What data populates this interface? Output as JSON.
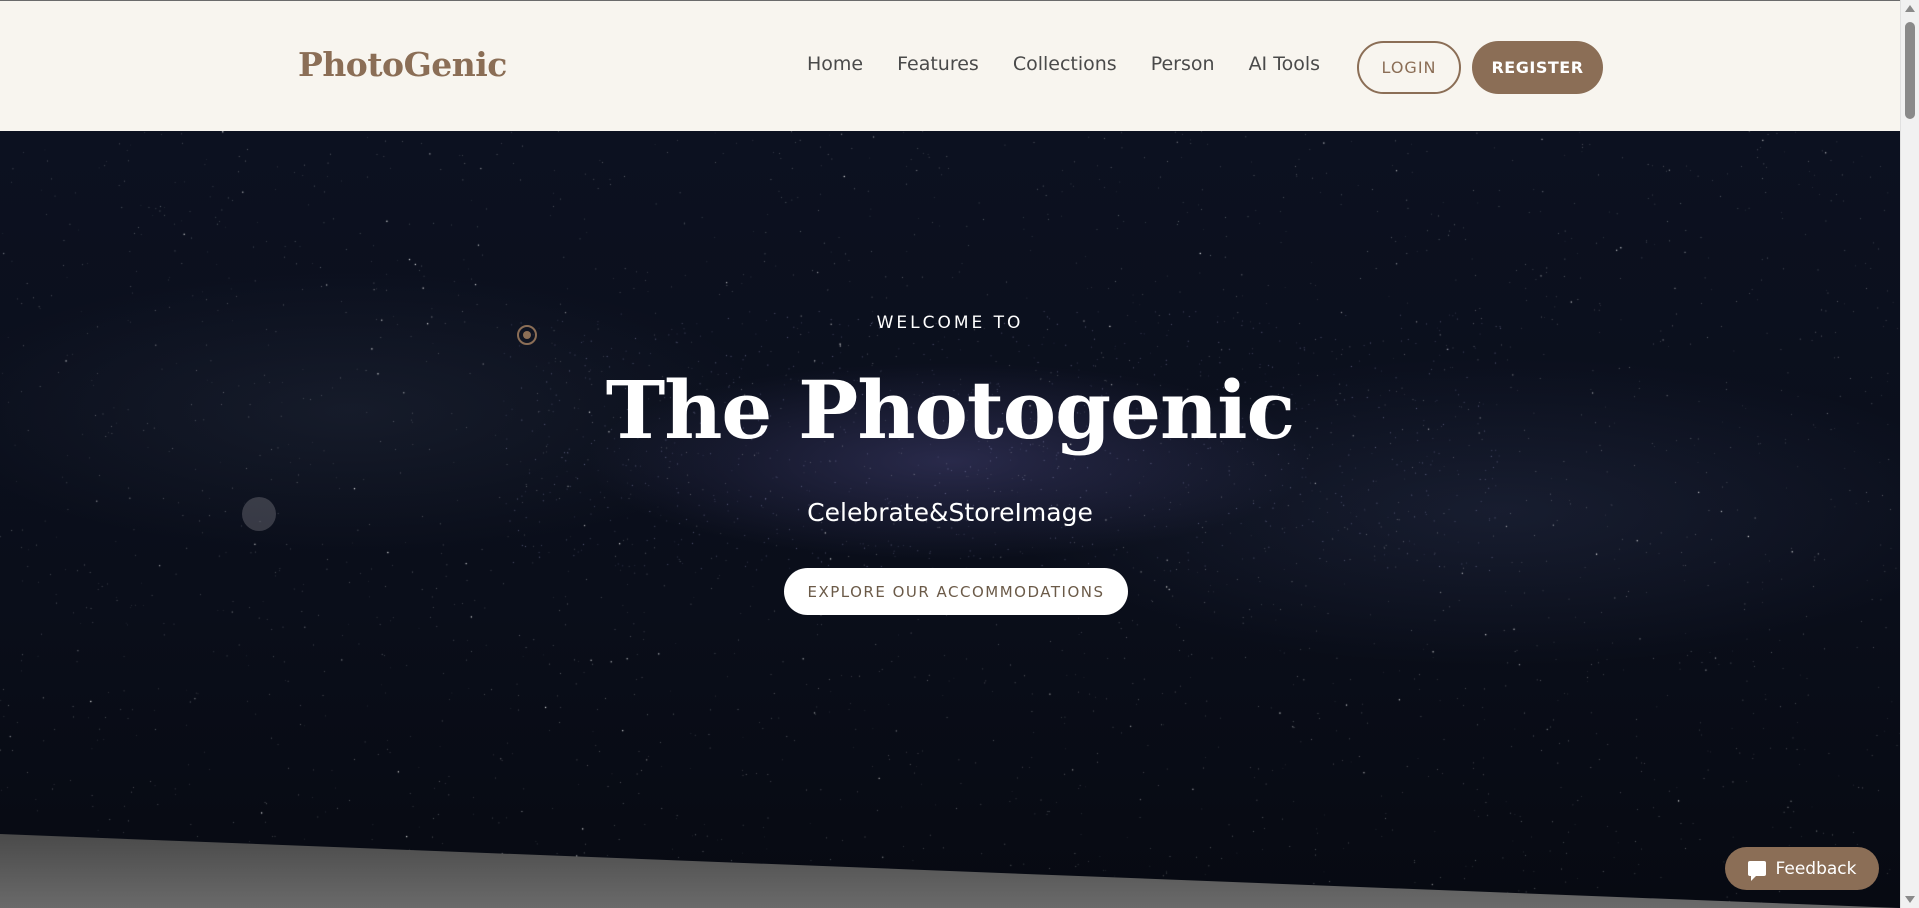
{
  "header": {
    "logo": "PhotoGenic",
    "nav": [
      "Home",
      "Features",
      "Collections",
      "Person",
      "AI Tools"
    ],
    "login_label": "LOGIN",
    "register_label": "REGISTER"
  },
  "hero": {
    "welcome": "WELCOME TO",
    "title": "The Photogenic",
    "subtitle": "Celebrate&StoreImage",
    "cta_label": "EXPLORE OUR ACCOMMODATIONS"
  },
  "feedback": {
    "label": "Feedback",
    "icon": "chat-bubble-icon"
  },
  "colors": {
    "brand": "#8b6e56",
    "header_bg": "#f8f5ef",
    "hero_bg": "#0b0f1c",
    "text_dark": "#4a4a4a",
    "slant_bottom": "#5c5c5c"
  }
}
